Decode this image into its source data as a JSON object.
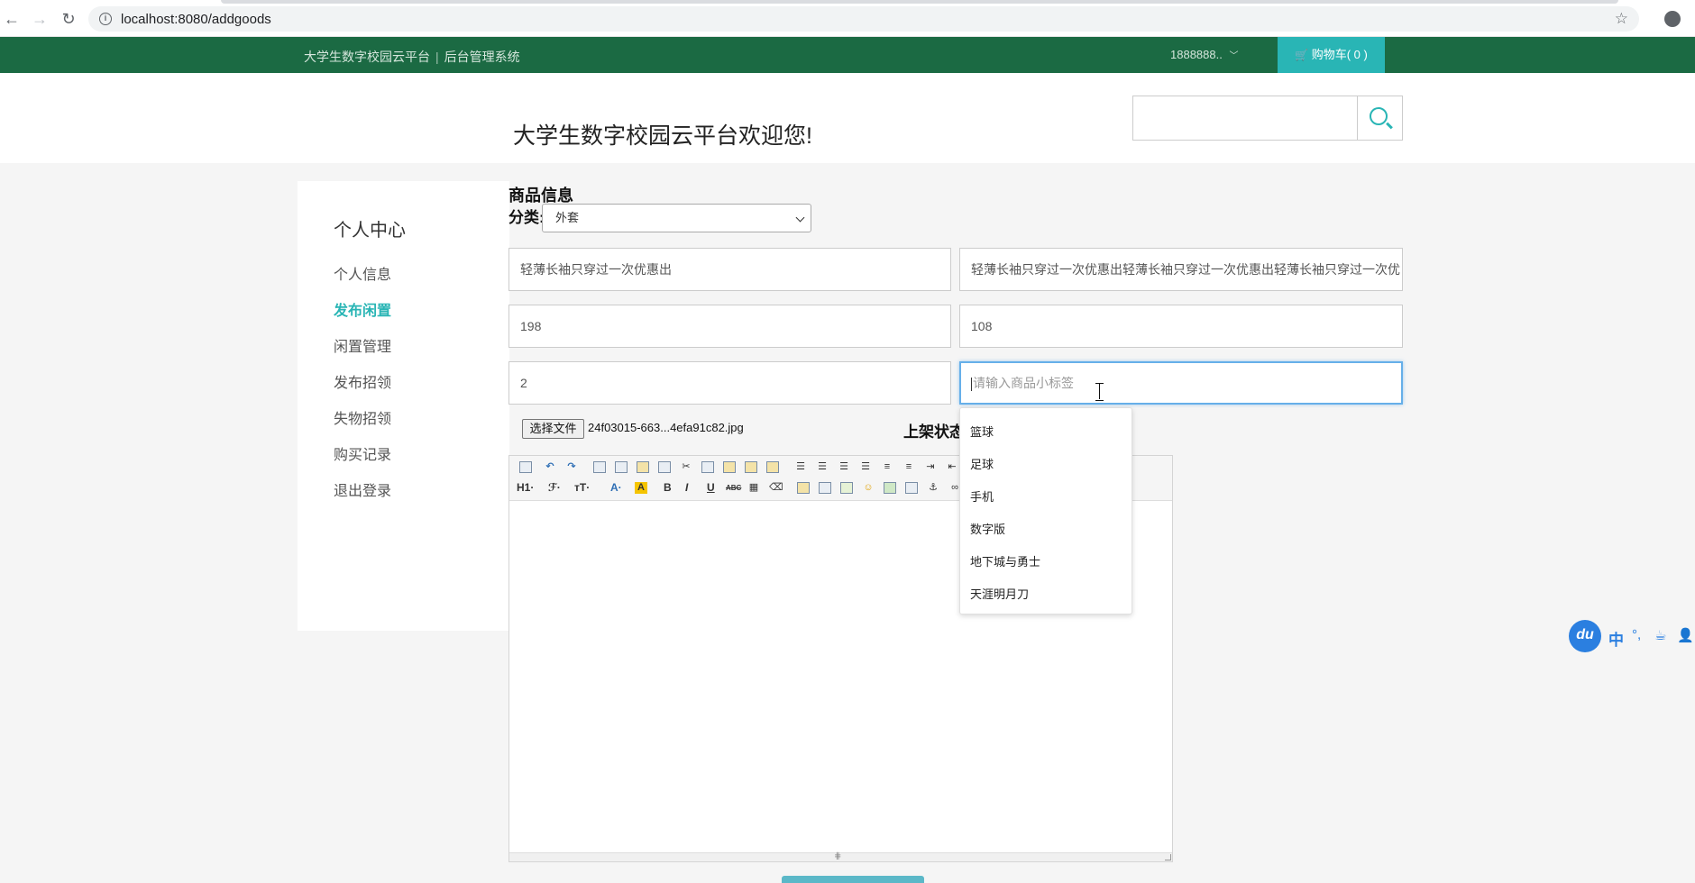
{
  "browser": {
    "url": "localhost:8080/addgoods",
    "back": "←",
    "forward": "→",
    "reload": "↻",
    "info": "i",
    "star": "☆"
  },
  "topbar": {
    "site_name": "大学生数字校园云平台",
    "separator": "|",
    "admin_link": "后台管理系统",
    "user": "1888888..",
    "user_caret": "﹀",
    "cart": "购物车( 0 )",
    "cart_icon": "🛒",
    "colors": {
      "bar": "#1b6a43",
      "accent": "#29b5b5"
    }
  },
  "header": {
    "welcome": "大学生数字校园云平台欢迎您!",
    "search_placeholder": ""
  },
  "sidebar": {
    "title": "个人中心",
    "items": [
      {
        "label": "个人信息",
        "active": false
      },
      {
        "label": "发布闲置",
        "active": true
      },
      {
        "label": "闲置管理",
        "active": false
      },
      {
        "label": "发布招领",
        "active": false
      },
      {
        "label": "失物招领",
        "active": false
      },
      {
        "label": "购买记录",
        "active": false
      },
      {
        "label": "退出登录",
        "active": false
      }
    ]
  },
  "form": {
    "title": "商品信息",
    "category_label": "分类:",
    "category_value": "外套",
    "name_value": "轻薄长袖只穿过一次优惠出",
    "desc_value": "轻薄长袖只穿过一次优惠出轻薄长袖只穿过一次优惠出轻薄长袖只穿过一次优",
    "price_value": "198",
    "orig_price_value": "108",
    "count_value": "2",
    "tag_placeholder": "请输入商品小标签",
    "file_button": "选择文件",
    "file_name": "24f03015-663...4efa91c82.jpg",
    "status_label": "上架状态"
  },
  "tag_suggestions": [
    "篮球",
    "足球",
    "手机",
    "数字版",
    "地下城与勇士",
    "天涯明月刀"
  ],
  "editor": {
    "toolbar_row1": [
      "source",
      "undo",
      "redo",
      "preview",
      "print",
      "template",
      "code",
      "cut",
      "copy",
      "paste",
      "paste-text",
      "paste-word",
      "align-left",
      "align-center",
      "align-right",
      "justify",
      "ordered-list",
      "unordered-list",
      "indent",
      "outdent"
    ],
    "toolbar_row2_text": {
      "h1": "H1·",
      "font": "ℱ·",
      "size": "ᴛT·",
      "color": "A·",
      "bg": "A",
      "bold": "B",
      "italic": "I",
      "underline": "U",
      "strike": "ABC"
    },
    "grip": "⋕"
  },
  "ime": {
    "logo": "du",
    "lang": "中",
    "punct": "°,",
    "icon1": "☕",
    "icon2": "👤"
  }
}
